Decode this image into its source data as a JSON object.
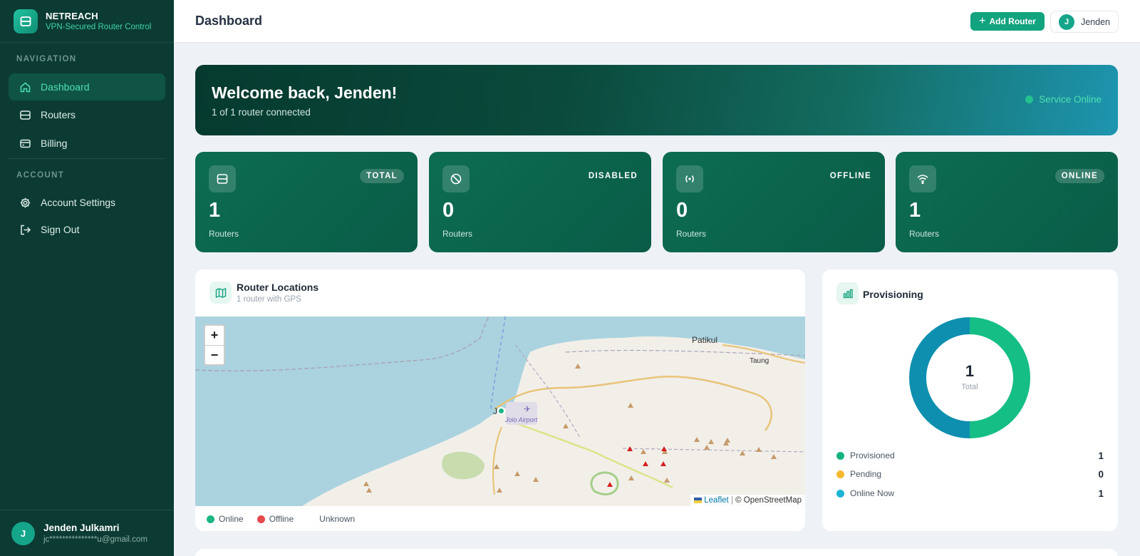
{
  "brand": {
    "name": "NETREACH",
    "tagline": "VPN-Secured Router Control"
  },
  "sidebar": {
    "nav_heading": "NAVIGATION",
    "account_heading": "ACCOUNT",
    "nav_items": [
      {
        "label": "Dashboard",
        "icon": "home-icon",
        "active": true
      },
      {
        "label": "Routers",
        "icon": "router-icon"
      },
      {
        "label": "Billing",
        "icon": "credit-card-icon"
      }
    ],
    "account_items": [
      {
        "label": "Account Settings",
        "icon": "gear-icon"
      },
      {
        "label": "Sign Out",
        "icon": "sign-out-icon"
      }
    ],
    "user": {
      "initial": "J",
      "name": "Jenden Julkamri",
      "email": "jc***************u@gmail.com"
    }
  },
  "header": {
    "title": "Dashboard",
    "add_router_label": "Add Router",
    "user_initial": "J",
    "user_name": "Jenden"
  },
  "banner": {
    "title": "Welcome back, Jenden!",
    "subtitle": "1 of 1 router connected",
    "status": "Service Online"
  },
  "stats": [
    {
      "badge": "TOTAL",
      "value": "1",
      "label": "Routers",
      "icon": "router-icon"
    },
    {
      "badge": "DISABLED",
      "value": "0",
      "label": "Routers",
      "icon": "ban-icon"
    },
    {
      "badge": "OFFLINE",
      "value": "0",
      "label": "Routers",
      "icon": "signal-off-icon"
    },
    {
      "badge": "ONLINE",
      "value": "1",
      "label": "Routers",
      "icon": "wifi-icon"
    }
  ],
  "map": {
    "title": "Router Locations",
    "subtitle": "1 router with GPS",
    "places": {
      "patikul": "Patikul",
      "taung": "Taung",
      "airport": "Jolo Airport",
      "jolo": "J"
    },
    "attribution": {
      "leaflet": "Leaflet",
      "osm": "© OpenStreetMap"
    },
    "legend": [
      {
        "label": "Online",
        "color": "#1db584"
      },
      {
        "label": "Offline",
        "color": "#e5484d"
      },
      {
        "label": "Unknown",
        "color": "#ffffff"
      }
    ]
  },
  "provisioning": {
    "title": "Provisioning",
    "total_value": "1",
    "total_label": "Total",
    "rows": [
      {
        "label": "Provisioned",
        "value": "1",
        "color": "#15b27f"
      },
      {
        "label": "Pending",
        "value": "0",
        "color": "#f5b82e"
      },
      {
        "label": "Online Now",
        "value": "1",
        "color": "#1cb3d4"
      }
    ],
    "chart_colors": {
      "provisioned": "#15be84",
      "online": "#0e8fb0"
    }
  }
}
